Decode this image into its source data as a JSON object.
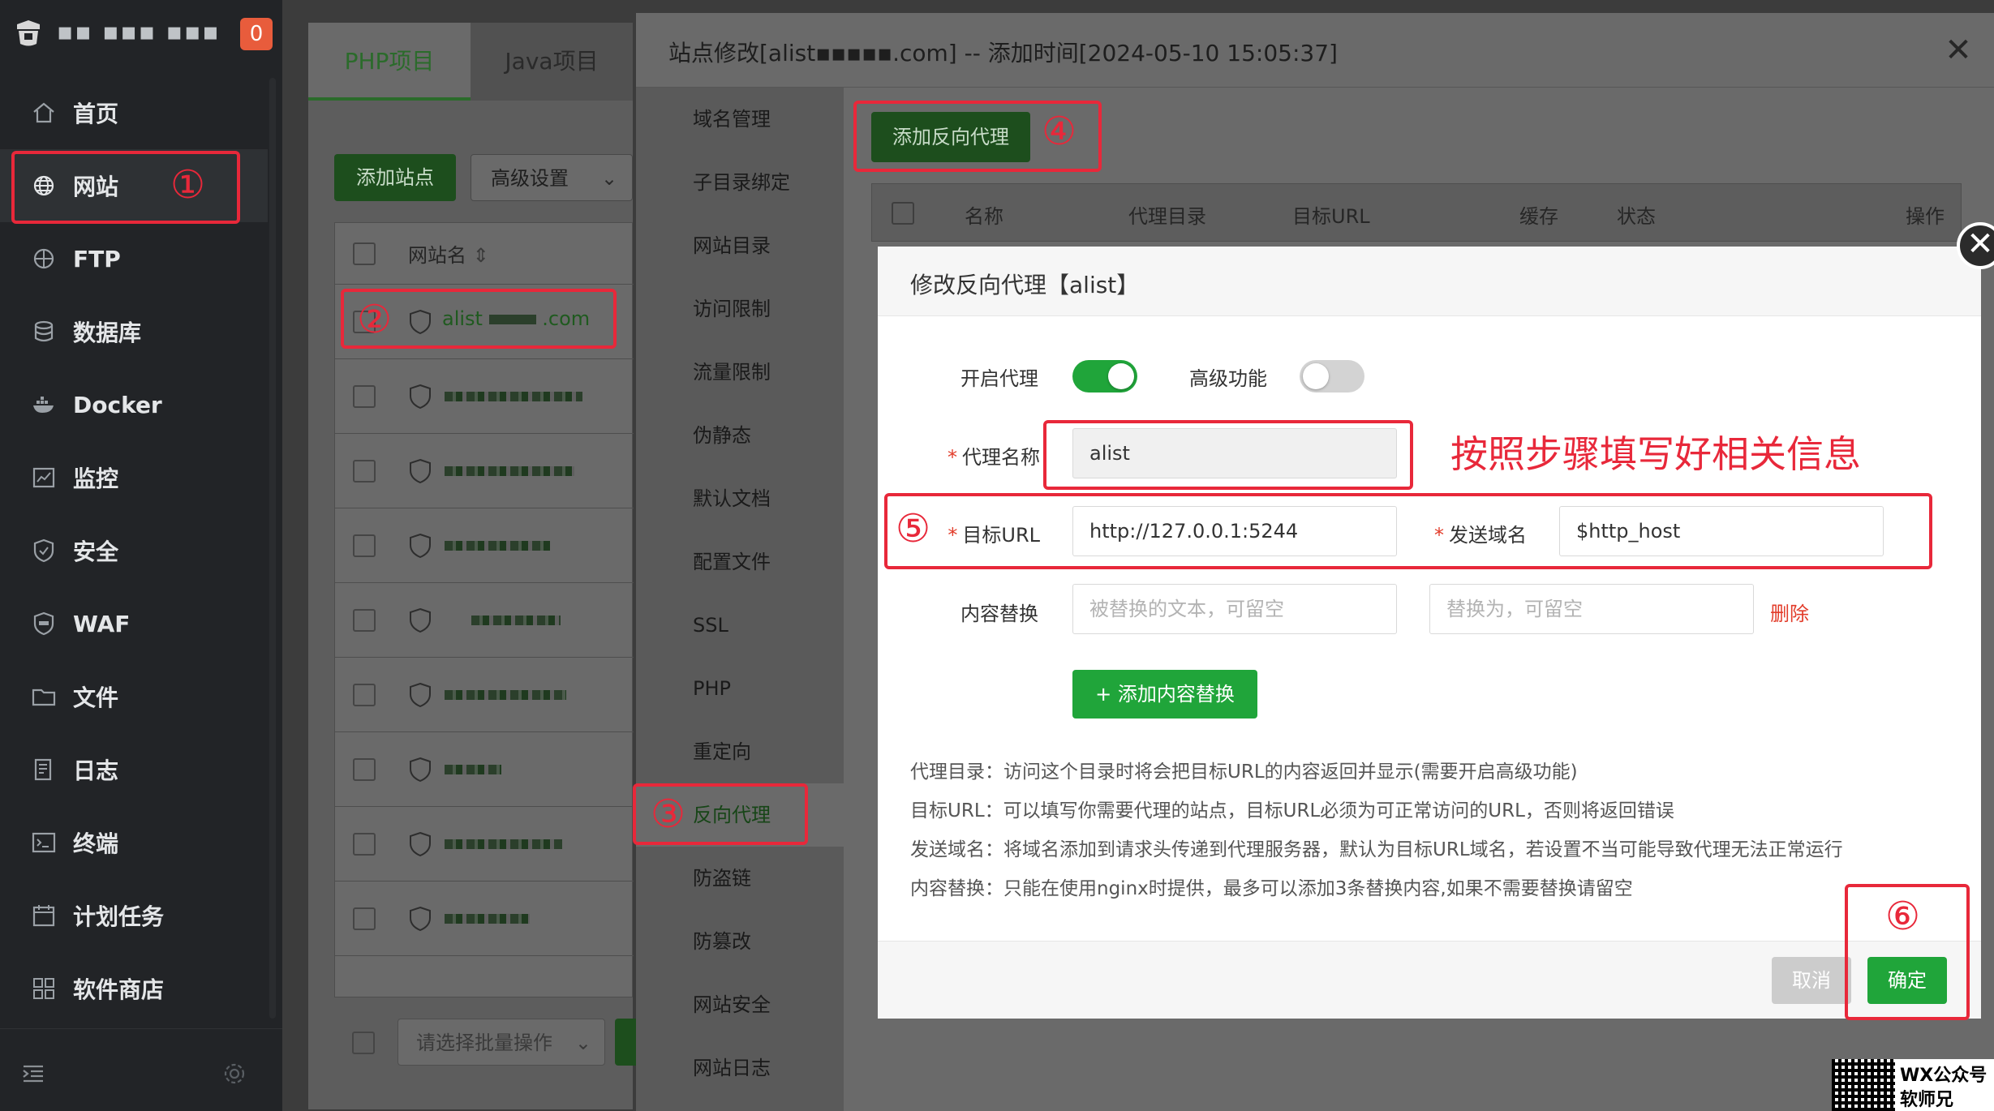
{
  "sidebar": {
    "brand_text": "▪▪ ▪▪▪ ▪▪▪",
    "badge": "0",
    "items": [
      {
        "label": "首页",
        "icon": "home-icon"
      },
      {
        "label": "网站",
        "icon": "globe-icon"
      },
      {
        "label": "FTP",
        "icon": "ftp-icon"
      },
      {
        "label": "数据库",
        "icon": "database-icon"
      },
      {
        "label": "Docker",
        "icon": "docker-icon"
      },
      {
        "label": "监控",
        "icon": "monitor-icon"
      },
      {
        "label": "安全",
        "icon": "shield-icon"
      },
      {
        "label": "WAF",
        "icon": "waf-icon"
      },
      {
        "label": "文件",
        "icon": "folder-icon"
      },
      {
        "label": "日志",
        "icon": "log-icon"
      },
      {
        "label": "终端",
        "icon": "terminal-icon"
      },
      {
        "label": "计划任务",
        "icon": "calendar-icon"
      },
      {
        "label": "软件商店",
        "icon": "apps-icon"
      }
    ],
    "active_index": 1
  },
  "site_panel": {
    "tabs": [
      "PHP项目",
      "Java项目"
    ],
    "add_site_label": "添加站点",
    "advanced_label": "高级设置",
    "column_site_name": "网站名",
    "first_site_prefix": "alist",
    "first_site_suffix": ".com",
    "batch_placeholder": "请选择批量操作"
  },
  "edit_window": {
    "title": "站点修改[alist▪▪▪▪▪.com] -- 添加时间[2024-05-10 15:05:37]",
    "menu": [
      "域名管理",
      "子目录绑定",
      "网站目录",
      "访问限制",
      "流量限制",
      "伪静态",
      "默认文档",
      "配置文件",
      "SSL",
      "PHP",
      "重定向",
      "反向代理",
      "防盗链",
      "防篡改",
      "网站安全",
      "网站日志"
    ],
    "active_menu_index": 11,
    "add_proxy_label": "添加反向代理",
    "table_headers": [
      "名称",
      "代理目录",
      "目标URL",
      "缓存",
      "状态",
      "操作"
    ]
  },
  "modal": {
    "title": "修改反向代理【alist】",
    "enable_proxy_label": "开启代理",
    "enable_proxy_on": true,
    "advanced_label": "高级功能",
    "advanced_on": false,
    "proxy_name_label": "代理名称",
    "proxy_name_value": "alist",
    "target_url_label": "目标URL",
    "target_url_value": "http://127.0.0.1:5244",
    "send_domain_label": "发送域名",
    "send_domain_value": "$http_host",
    "content_replace_label": "内容替换",
    "replace_from_placeholder": "被替换的文本，可留空",
    "replace_to_placeholder": "替换为，可留空",
    "delete_label": "删除",
    "add_replace_label": "+ 添加内容替换",
    "tips": [
      "代理目录：访问这个目录时将会把目标URL的内容返回并显示(需要开启高级功能)",
      "目标URL：可以填写你需要代理的站点，目标URL必须为可正常访问的URL，否则将返回错误",
      "发送域名：将域名添加到请求头传递到代理服务器，默认为目标URL域名，若设置不当可能导致代理无法正常运行",
      "内容替换：只能在使用nginx时提供，最多可以添加3条替换内容,如果不需要替换请留空"
    ],
    "cancel_label": "取消",
    "confirm_label": "确定",
    "close_symbol": "✕"
  },
  "annotations": {
    "step1": "①",
    "step2": "②",
    "step3": "③",
    "step4": "④",
    "step5": "⑤",
    "step6": "⑥",
    "instruction": "按照步骤填写好相关信息",
    "color": "#e8283a"
  },
  "watermark": {
    "line1": "WX公众号",
    "line2": "软师兄"
  },
  "colors": {
    "sidebar_bg": "#222427",
    "accent_green": "#20a53a",
    "danger_red": "#e23c2a"
  }
}
